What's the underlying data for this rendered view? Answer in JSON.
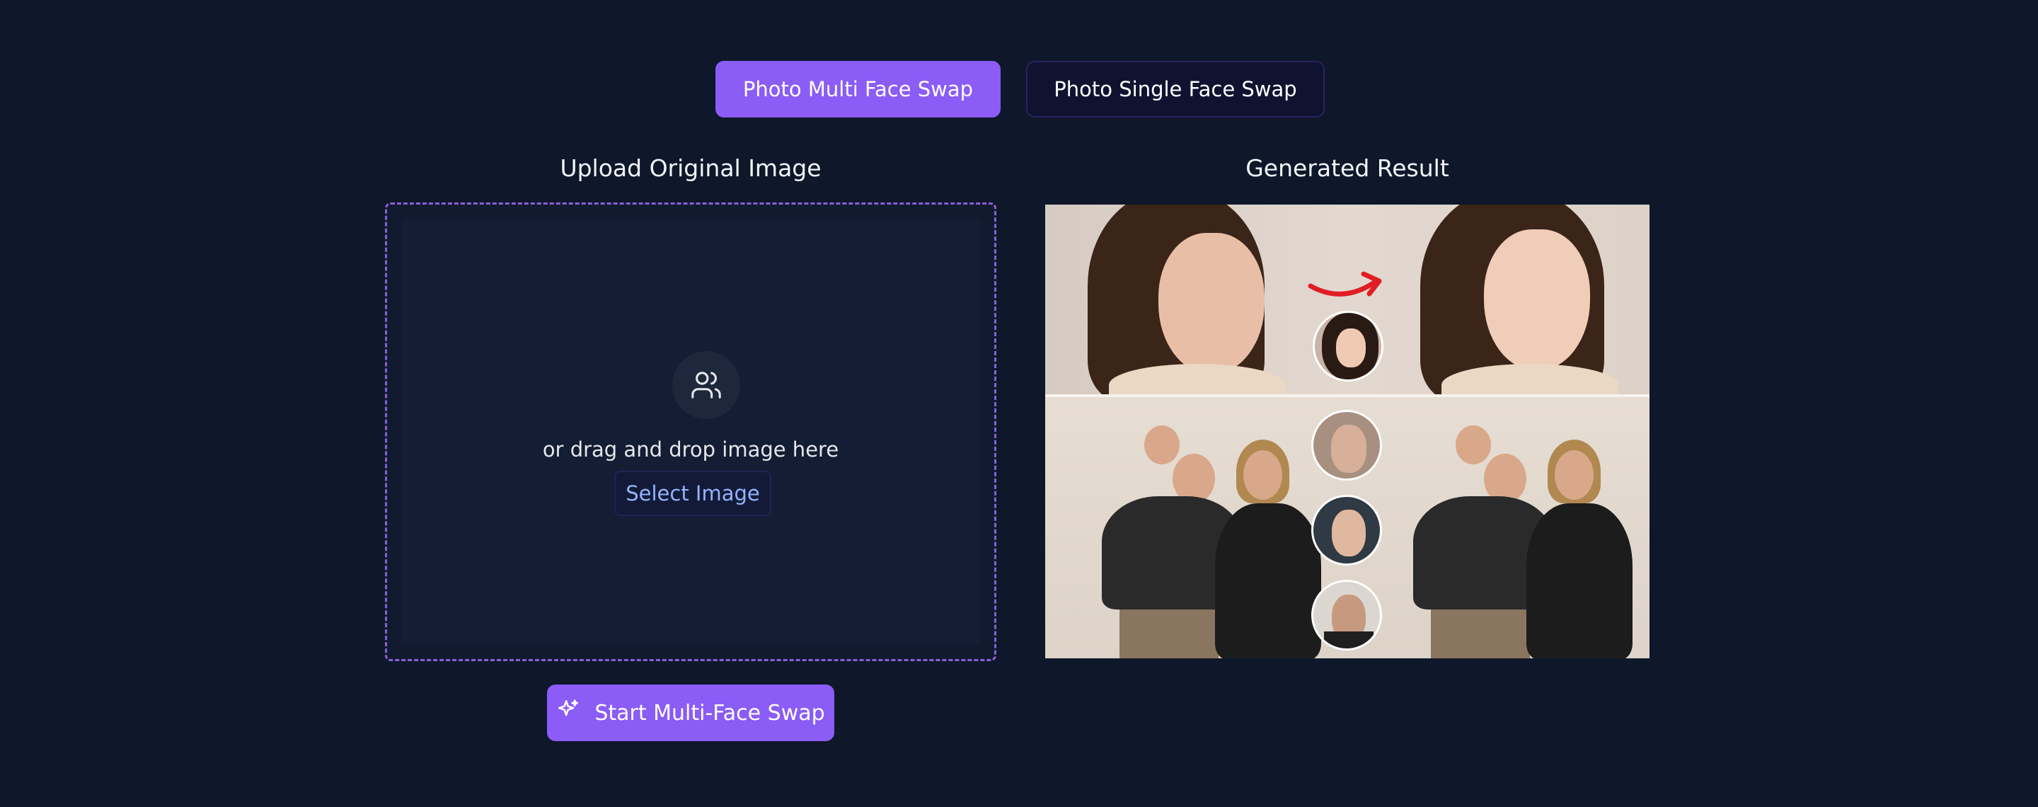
{
  "tabs": {
    "multi": "Photo Multi Face Swap",
    "single": "Photo Single Face Swap"
  },
  "upload": {
    "title": "Upload Original Image",
    "drop_text": "or drag and drop image here",
    "select_label": "Select Image"
  },
  "result": {
    "title": "Generated Result"
  },
  "actions": {
    "start_label": "Start Multi-Face Swap"
  },
  "icons": {
    "upload": "users-icon",
    "start": "sparkles-icon",
    "swap_arrow": "curved-arrow-icon"
  },
  "colors": {
    "accent": "#8b5cf6",
    "background": "#0f172a",
    "link": "#93b4fb"
  }
}
